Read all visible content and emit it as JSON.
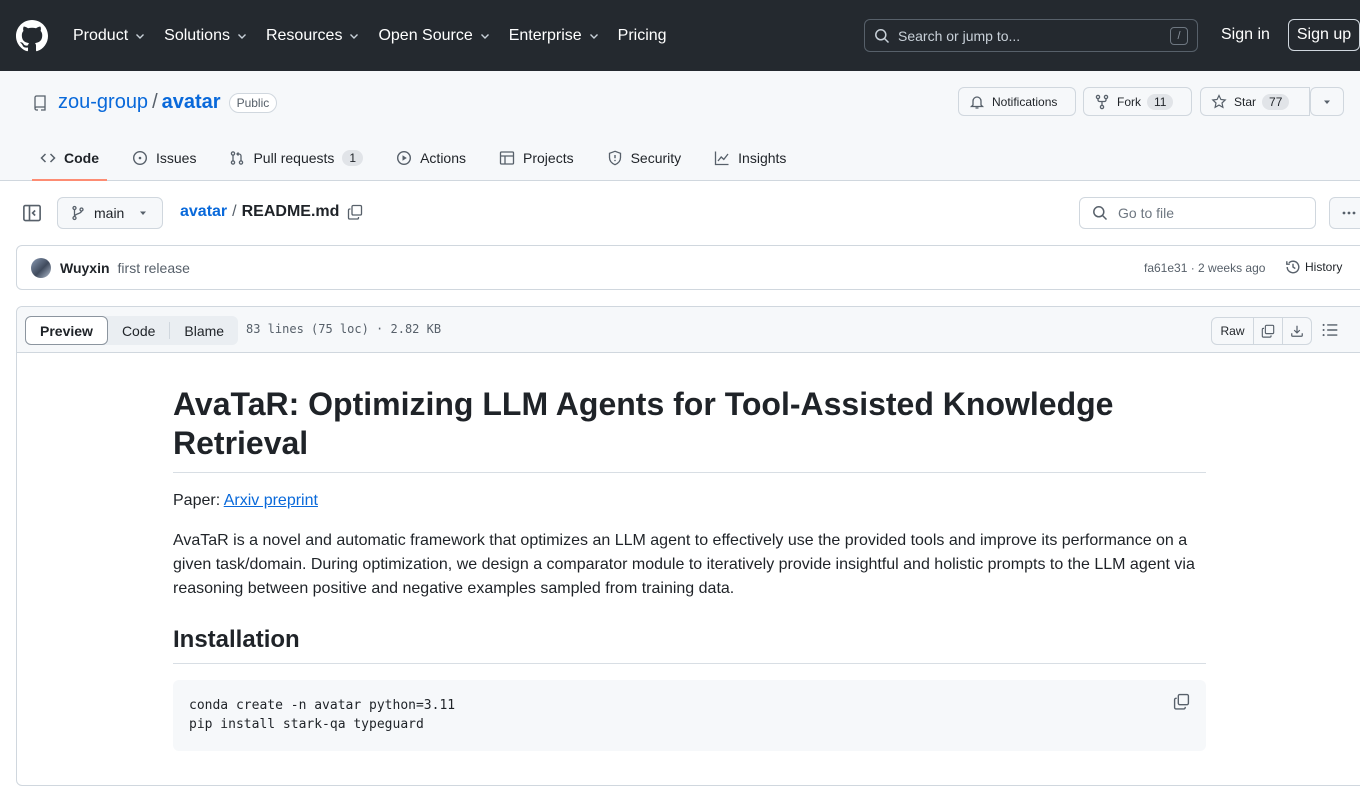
{
  "header": {
    "nav": [
      {
        "label": "Product",
        "has_menu": true
      },
      {
        "label": "Solutions",
        "has_menu": true
      },
      {
        "label": "Resources",
        "has_menu": true
      },
      {
        "label": "Open Source",
        "has_menu": true
      },
      {
        "label": "Enterprise",
        "has_menu": true
      },
      {
        "label": "Pricing",
        "has_menu": false
      }
    ],
    "search_placeholder": "Search or jump to...",
    "search_shortcut": "/",
    "sign_in": "Sign in",
    "sign_up": "Sign up"
  },
  "repo": {
    "owner": "zou-group",
    "separator": "/",
    "name": "avatar",
    "visibility": "Public",
    "notifications_label": "Notifications",
    "fork_label": "Fork",
    "fork_count": "11",
    "star_label": "Star",
    "star_count": "77"
  },
  "tabs": [
    {
      "label": "Code",
      "icon": "code-icon",
      "active": true,
      "count": ""
    },
    {
      "label": "Issues",
      "icon": "issue-icon",
      "active": false,
      "count": ""
    },
    {
      "label": "Pull requests",
      "icon": "pull-request-icon",
      "active": false,
      "count": "1"
    },
    {
      "label": "Actions",
      "icon": "play-icon",
      "active": false,
      "count": ""
    },
    {
      "label": "Projects",
      "icon": "table-icon",
      "active": false,
      "count": ""
    },
    {
      "label": "Security",
      "icon": "shield-icon",
      "active": false,
      "count": ""
    },
    {
      "label": "Insights",
      "icon": "graph-icon",
      "active": false,
      "count": ""
    }
  ],
  "filenav": {
    "branch": "main",
    "crumb_repo": "avatar",
    "crumb_sep": "/",
    "crumb_file": "README.md",
    "goto_placeholder": "Go to file"
  },
  "commit": {
    "author": "Wuyxin",
    "message": "first release",
    "meta": "fa61e31 · 2 weeks ago",
    "history_label": "History"
  },
  "file": {
    "view_modes": [
      "Preview",
      "Code",
      "Blame"
    ],
    "active_mode": "Preview",
    "info": "83 lines (75 loc) · 2.82 KB",
    "raw_label": "Raw"
  },
  "readme": {
    "title": "AvaTaR: Optimizing LLM Agents for Tool-Assisted Knowledge Retrieval",
    "paper_prefix": "Paper: ",
    "paper_link": "Arxiv preprint",
    "description": "AvaTaR is a novel and automatic framework that optimizes an LLM agent to effectively use the provided tools and improve its performance on a given task/domain. During optimization, we design a comparator module to iteratively provide insightful and holistic prompts to the LLM agent via reasoning between positive and negative examples sampled from training data.",
    "install_heading": "Installation",
    "install_code_line1": "conda create -n avatar python=3.11",
    "install_code_line2": "pip install stark-qa typeguard"
  },
  "colors": {
    "header_bg": "#24292f",
    "link": "#0969da",
    "active_tab_underline": "#fd8c73"
  }
}
